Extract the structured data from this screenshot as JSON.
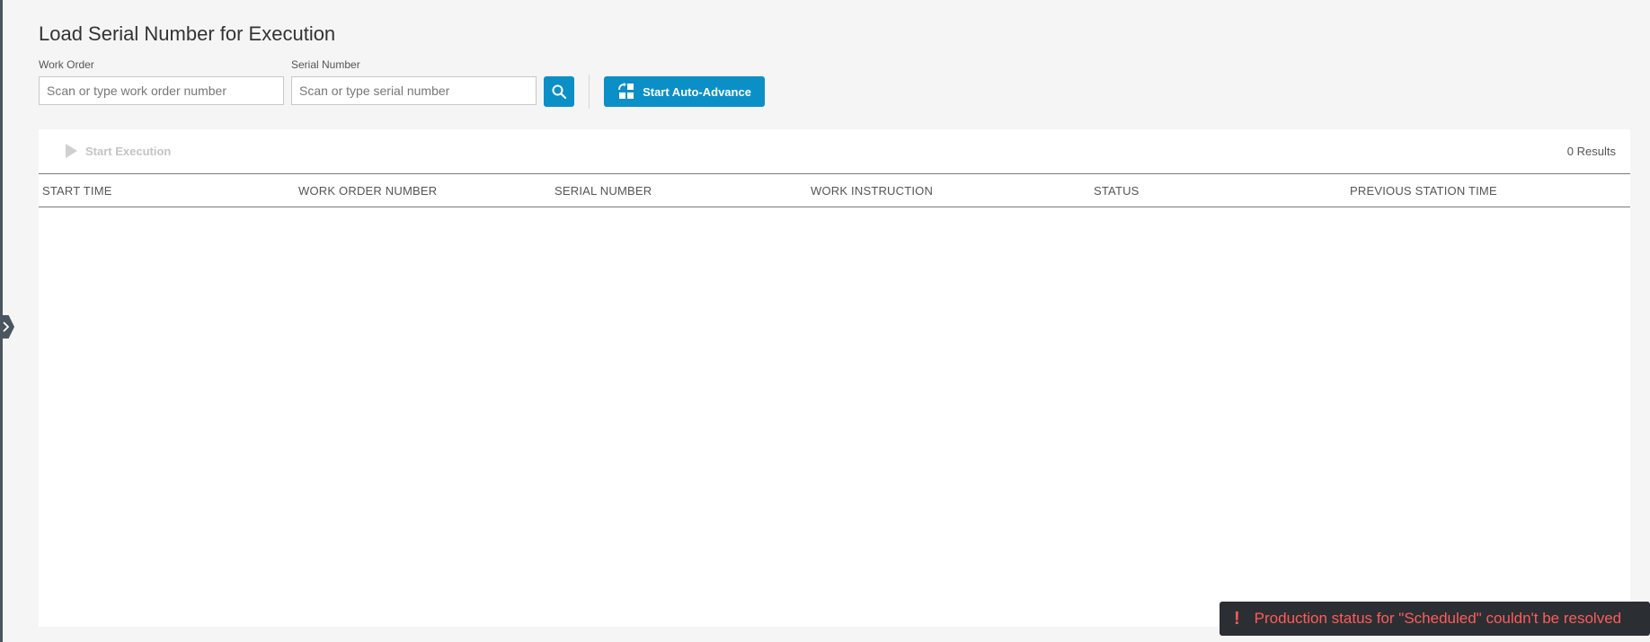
{
  "page": {
    "title": "Load Serial Number for Execution"
  },
  "form": {
    "work_order": {
      "label": "Work Order",
      "placeholder": "Scan or type work order number",
      "value": ""
    },
    "serial_number": {
      "label": "Serial Number",
      "placeholder": "Scan or type serial number",
      "value": ""
    },
    "search_icon": "search-icon",
    "auto_advance": {
      "label": "Start Auto-Advance",
      "icon": "auto-advance-icon"
    }
  },
  "table": {
    "start_execution_label": "Start Execution",
    "start_execution_icon": "play-icon",
    "results_text": "0 Results",
    "columns": [
      "START TIME",
      "WORK ORDER NUMBER",
      "SERIAL NUMBER",
      "WORK INSTRUCTION",
      "STATUS",
      "PREVIOUS STATION TIME"
    ],
    "rows": []
  },
  "toast": {
    "icon": "exclamation-icon",
    "symbol": "!",
    "message": "Production status for \"Scheduled\" couldn't be resolved"
  },
  "colors": {
    "accent": "#0b8fc7",
    "toast_bg": "#2b2f33",
    "toast_text": "#ff5b5b"
  }
}
